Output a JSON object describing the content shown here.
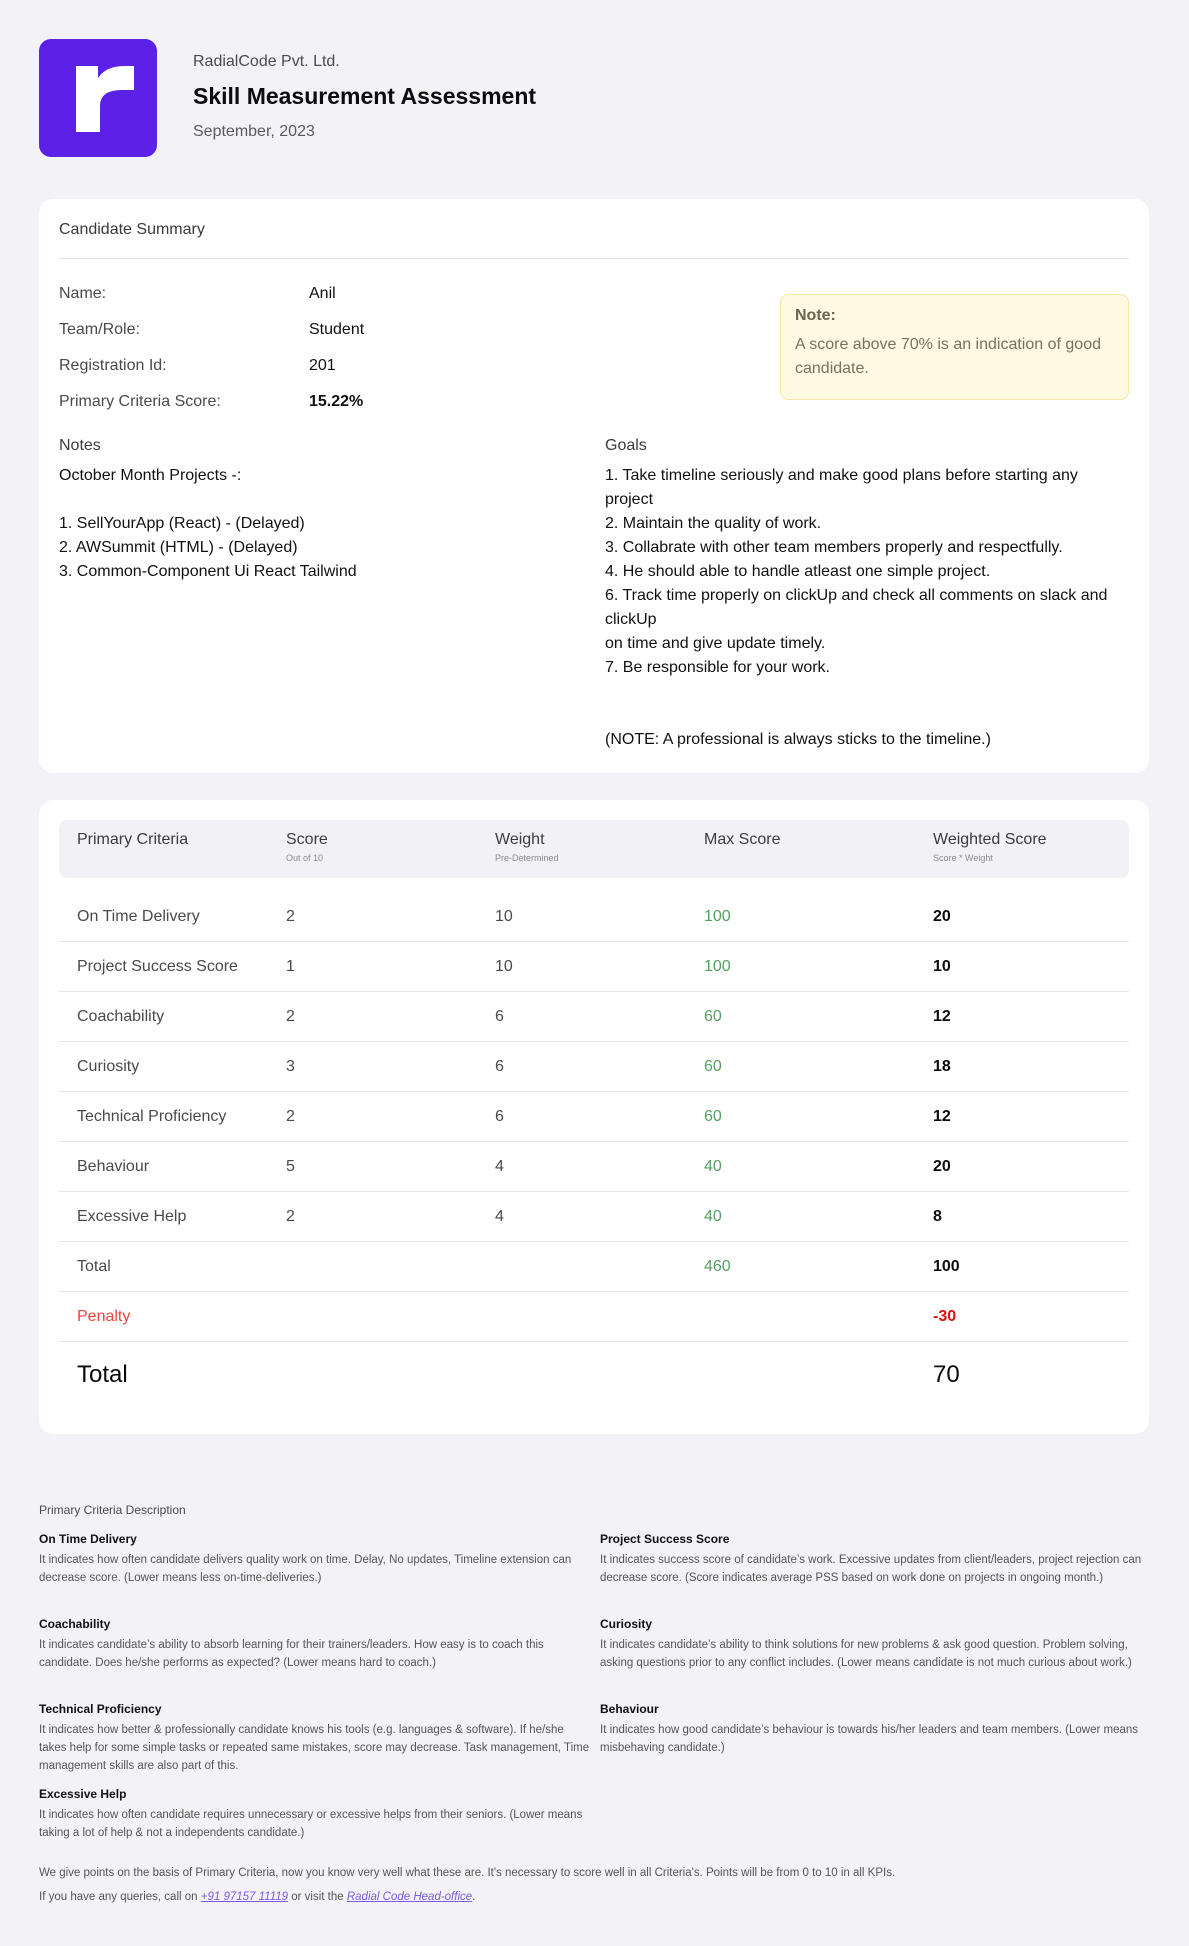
{
  "header": {
    "company": "RadialCode Pvt. Ltd.",
    "title": "Skill Measurement Assessment",
    "date": "September, 2023",
    "brand_color": "#5b21e6"
  },
  "summary": {
    "heading": "Candidate Summary",
    "fields": [
      {
        "label": "Name:",
        "value": "Anil"
      },
      {
        "label": "Team/Role:",
        "value": "Student"
      },
      {
        "label": "Registration Id:",
        "value": "201"
      },
      {
        "label": "Primary Criteria Score:",
        "value": "15.22%"
      }
    ],
    "note": {
      "title": "Note:",
      "text": "A score above 70% is an indication of good candidate."
    },
    "notes_label": "Notes",
    "notes_text": "October Month Projects -:\n\n1. SellYourApp (React) - (Delayed)\n2. AWSummit (HTML) - (Delayed)\n3. Common-Component Ui  React Tailwind",
    "goals_label": "Goals",
    "goals_text": "1. Take timeline seriously and make good plans before starting any project\n2. Maintain the quality of work.\n3. Collabrate with other team members properly and respectfully.\n4. He should able to handle atleast one simple project.\n6. Track time properly on clickUp and check all comments on slack and clickUp\non time and give update timely.\n7. Be responsible for your work.\n\n\n(NOTE:  A professional is always sticks to the timeline.)"
  },
  "table": {
    "columns": [
      {
        "title": "Primary Criteria",
        "sub": ""
      },
      {
        "title": "Score",
        "sub": "Out of 10"
      },
      {
        "title": "Weight",
        "sub": "Pre-Determined"
      },
      {
        "title": "Max Score",
        "sub": ""
      },
      {
        "title": "Weighted Score",
        "sub": "Score * Weight"
      }
    ],
    "rows": [
      [
        "On Time Delivery",
        "2",
        "10",
        "100",
        "20"
      ],
      [
        "Project Success Score",
        "1",
        "10",
        "100",
        "10"
      ],
      [
        "Coachability",
        "2",
        "6",
        "60",
        "12"
      ],
      [
        "Curiosity",
        "3",
        "6",
        "60",
        "18"
      ],
      [
        "Technical Proficiency",
        "2",
        "6",
        "60",
        "12"
      ],
      [
        "Behaviour",
        "5",
        "4",
        "40",
        "20"
      ],
      [
        "Excessive Help",
        "2",
        "4",
        "40",
        "8"
      ]
    ],
    "total": {
      "label": "Total",
      "max": "460",
      "weighted": "100"
    },
    "penalty": {
      "label": "Penalty",
      "value": "-30"
    },
    "grand_total": {
      "label": "Total",
      "value": "70"
    }
  },
  "descriptions": {
    "title": "Primary Criteria Description",
    "items": [
      {
        "heading": "On Time Delivery",
        "text": "It indicates how often candidate delivers quality work on time. Delay, No updates, Timeline extension can decrease score. (Lower means less on-time-deliveries.)"
      },
      {
        "heading": "Project Success Score",
        "text": "It indicates success score of candidate’s work. Excessive updates from client/leaders, project rejection can decrease score. (Score indicates average PSS based on work done on projects in ongoing month.)"
      },
      {
        "heading": "Coachability",
        "text": "It indicates candidate’s ability to absorb learning for their trainers/leaders. How easy is to coach this candidate. Does he/she performs as expected? (Lower means hard to coach.)"
      },
      {
        "heading": "Curiosity",
        "text": "It indicates candidate’s ability to think solutions for new problems & ask good question. Problem solving, asking questions prior to any conflict includes. (Lower means candidate is not much curious about work.)"
      },
      {
        "heading": "Technical Proficiency",
        "text": "It indicates how better & professionally candidate knows his tools (e.g. languages & software). If he/she takes help for some simple tasks or repeated same mistakes, score may decrease. Task management, Time management skills are also part of this."
      },
      {
        "heading": "Behaviour",
        "text": "It indicates how good candidate’s behaviour is towards his/her leaders and team members. (Lower means misbehaving candidate.)"
      },
      {
        "heading": "Excessive Help",
        "text": "It indicates how often candidate requires unnecessary or excessive helps from their seniors. (Lower means taking a lot of help & not a independents candidate.)"
      }
    ]
  },
  "footer": {
    "line1": "We give points on the basis of Primary Criteria, now you know very well what these are. It's necessary to score well in all Criteria's. Points will be from 0 to 10 in all KPIs.",
    "line2_pre": "If you have any queries, call on ",
    "phone": "+91 97157 11119",
    "line2_mid": " or visit the ",
    "office_link": "Radial Code Head-office",
    "line2_post": "."
  }
}
